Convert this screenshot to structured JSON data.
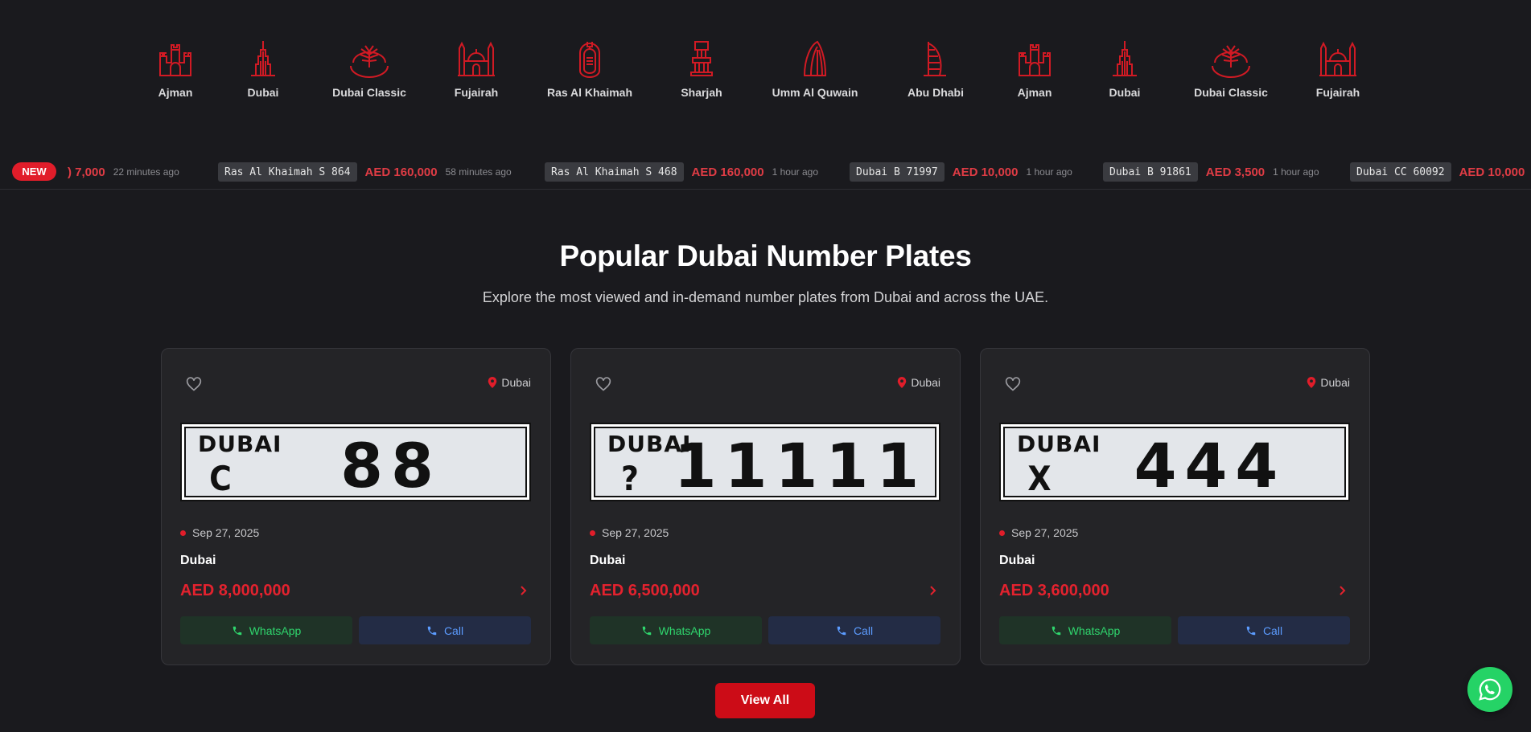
{
  "colors": {
    "accent": "#e11d2a",
    "price": "#e3222e",
    "whatsapp": "#25d366",
    "call": "#5c9cff",
    "background": "#1a1a1e"
  },
  "emirates": [
    {
      "name": "Ajman",
      "icon": "ajman-fort-icon"
    },
    {
      "name": "Dubai",
      "icon": "burj-khalifa-icon"
    },
    {
      "name": "Dubai Classic",
      "icon": "palm-island-icon"
    },
    {
      "name": "Fujairah",
      "icon": "mosque-icon"
    },
    {
      "name": "Ras Al Khaimah",
      "icon": "emblem-icon"
    },
    {
      "name": "Sharjah",
      "icon": "sharjah-monument-icon"
    },
    {
      "name": "Umm Al Quwain",
      "icon": "tower-icon"
    },
    {
      "name": "Abu Dhabi",
      "icon": "burj-al-arab-icon"
    },
    {
      "name": "Ajman",
      "icon": "ajman-fort-icon"
    },
    {
      "name": "Dubai",
      "icon": "burj-khalifa-icon"
    },
    {
      "name": "Dubai Classic",
      "icon": "palm-island-icon"
    },
    {
      "name": "Fujairah",
      "icon": "mosque-icon"
    }
  ],
  "ticker": {
    "badge": "NEW",
    "items": [
      {
        "plate": "",
        "price": ") 7,000",
        "time": "22 minutes ago"
      },
      {
        "plate": "Ras Al Khaimah S 864",
        "price": "AED 160,000",
        "time": "58 minutes ago"
      },
      {
        "plate": "Ras Al Khaimah S 468",
        "price": "AED 160,000",
        "time": "1 hour ago"
      },
      {
        "plate": "Dubai B 71997",
        "price": "AED 10,000",
        "time": "1 hour ago"
      },
      {
        "plate": "Dubai B 91861",
        "price": "AED 3,500",
        "time": "1 hour ago"
      },
      {
        "plate": "Dubai CC 60092",
        "price": "AED 10,000",
        "time": ""
      }
    ]
  },
  "section": {
    "title": "Popular Dubai Number Plates",
    "subtitle": "Explore the most viewed and in-demand number plates from Dubai and across the UAE."
  },
  "cards": [
    {
      "location": "Dubai",
      "plate_code": "C",
      "plate_number": "88",
      "plate_emirate": "DUBAI",
      "date": "Sep 27, 2025",
      "city": "Dubai",
      "price": "AED 8,000,000",
      "whatsapp_label": "WhatsApp",
      "call_label": "Call"
    },
    {
      "location": "Dubai",
      "plate_code": "?",
      "plate_number": "11111",
      "plate_emirate": "DUBAI",
      "date": "Sep 27, 2025",
      "city": "Dubai",
      "price": "AED 6,500,000",
      "whatsapp_label": "WhatsApp",
      "call_label": "Call"
    },
    {
      "location": "Dubai",
      "plate_code": "X",
      "plate_number": "444",
      "plate_emirate": "DUBAI",
      "date": "Sep 27, 2025",
      "city": "Dubai",
      "price": "AED 3,600,000",
      "whatsapp_label": "WhatsApp",
      "call_label": "Call"
    }
  ],
  "view_all_label": "View All"
}
